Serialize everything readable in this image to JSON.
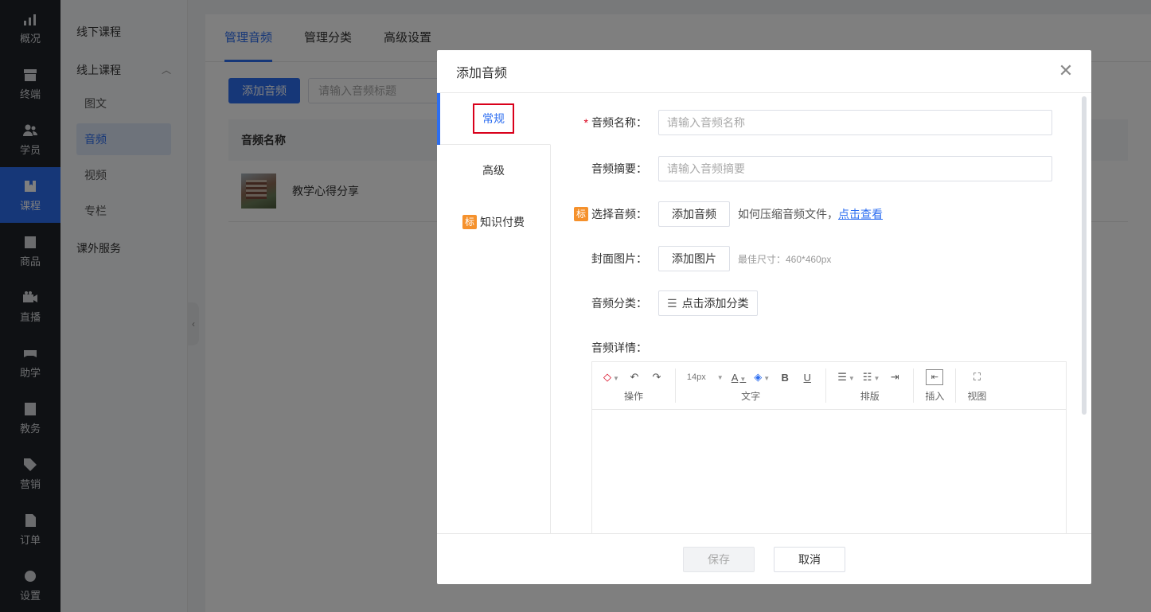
{
  "nav": {
    "items": [
      {
        "label": "概况",
        "icon": "chart-icon"
      },
      {
        "label": "终端",
        "icon": "store-icon"
      },
      {
        "label": "学员",
        "icon": "users-icon"
      },
      {
        "label": "课程",
        "icon": "book-icon"
      },
      {
        "label": "商品",
        "icon": "bag-icon"
      },
      {
        "label": "直播",
        "icon": "video-icon"
      },
      {
        "label": "助学",
        "icon": "gamepad-icon"
      },
      {
        "label": "教务",
        "icon": "clipboard-icon"
      },
      {
        "label": "营销",
        "icon": "tag-icon"
      },
      {
        "label": "订单",
        "icon": "document-icon"
      },
      {
        "label": "设置",
        "icon": "gear-icon"
      }
    ],
    "active_index": 3
  },
  "submenu": {
    "offline": "线下课程",
    "online": "线上课程",
    "online_items": [
      "图文",
      "音频",
      "视频",
      "专栏"
    ],
    "active": "音频",
    "extra": "课外服务",
    "collapse_glyph": "‹",
    "group_chevron": "︿"
  },
  "main": {
    "tabs": [
      "管理音频",
      "管理分类",
      "高级设置"
    ],
    "add_button": "添加音频",
    "search_placeholder": "请输入音频标题",
    "table_header": "音频名称",
    "rows": [
      {
        "title": "教学心得分享"
      }
    ]
  },
  "modal": {
    "title": "添加音频",
    "close_glyph": "✕",
    "side_tabs": {
      "general": "常规",
      "advanced": "高级",
      "paid_tag": "标",
      "paid": "知识付费"
    },
    "form": {
      "name_label": "音频名称：",
      "name_placeholder": "请输入音频名称",
      "summary_label": "音频摘要：",
      "summary_placeholder": "请输入音频摘要",
      "audio_tag": "标",
      "audio_label": "选择音频：",
      "audio_button": "添加音频",
      "audio_hint": "如何压缩音频文件，",
      "audio_link": "点击查看",
      "cover_label": "封面图片：",
      "cover_button": "添加图片",
      "cover_hint": "最佳尺寸：460*460px",
      "category_label": "音频分类：",
      "category_button": "点击添加分类",
      "detail_label": "音频详情："
    },
    "editor": {
      "groups": [
        "操作",
        "文字",
        "排版",
        "插入",
        "视图"
      ],
      "font_size": "14px"
    },
    "footer": {
      "save": "保存",
      "cancel": "取消"
    }
  }
}
